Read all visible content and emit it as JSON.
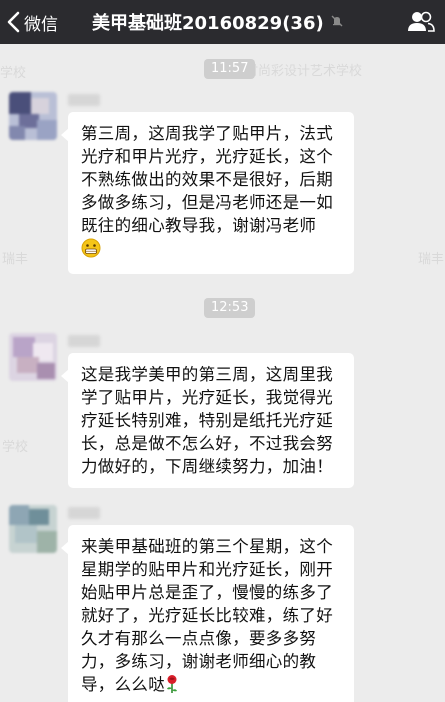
{
  "nav": {
    "back_label": "微信",
    "title": "美甲基础班20160829(36)"
  },
  "watermarks": [
    "意时尚彩设计艺术学校",
    "学校",
    "瑞丰",
    "学校",
    "瑞丰"
  ],
  "messages": [
    {
      "time": "11:57",
      "text": "第三周，这周我学了贴甲片，法式光疗和甲片光疗，光疗延长，这个不熟练做出的效果不是很好，后期多做多练习，但是冯老师还是一如既往的细心教导我，谢谢冯老师",
      "emoji": "grin-emoji"
    },
    {
      "time": "12:53",
      "text": "这是我学美甲的第三周，这周里我学了贴甲片，光疗延长，我觉得光疗延长特别难，特别是纸托光疗延长，总是做不怎么好，不过我会努力做好的，下周继续努力，加油！",
      "emoji": ""
    },
    {
      "time": "",
      "text": "来美甲基础班的第三个星期，这个星期学的贴甲片和光疗延长，刚开始贴甲片总是歪了，慢慢的练多了就好了，光疗延长比较难，练了好久才有那么一点点像，要多多努力，多练习，谢谢老师细心的教导，么么哒",
      "emoji": "rose-emoji"
    }
  ],
  "colors": {
    "nav_bg": "#2b2b2f",
    "chat_bg": "#ececec",
    "bubble_bg": "#ffffff",
    "time_pill_bg": "#cecece"
  }
}
